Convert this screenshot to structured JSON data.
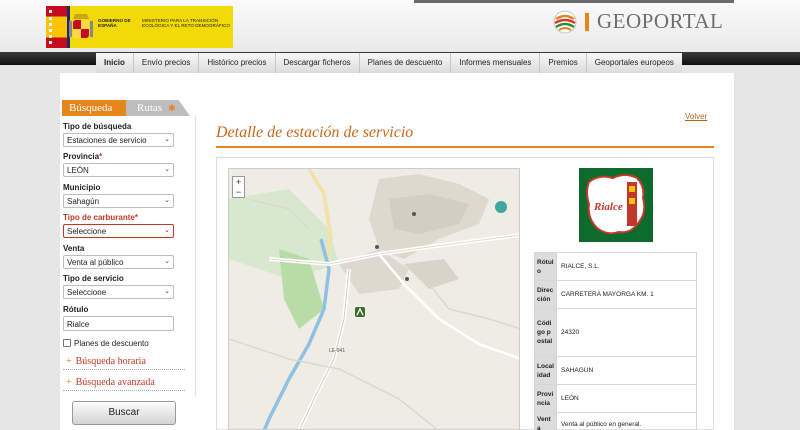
{
  "header": {
    "gov_text": "GOBIERNO DE ESPAÑA",
    "ministry_text": "MINISTERIO PARA LA TRANSICIÓN ECOLÓGICA Y EL RETO DEMOGRÁFICO",
    "brand": "GEOPORTAL"
  },
  "nav": {
    "items": [
      "Inicio",
      "Envío precios",
      "Histórico precios",
      "Descargar ficheros",
      "Planes de descuento",
      "Informes mensuales",
      "Premios",
      "Geoportales europeos"
    ]
  },
  "sidebar": {
    "tab_busqueda": "Búsqueda",
    "tab_rutas": "Rutas",
    "fields": {
      "tipo_busqueda": {
        "label": "Tipo de búsqueda",
        "value": "Estaciones de servicio"
      },
      "provincia": {
        "label": "Provincia",
        "value": "LEÓN"
      },
      "municipio": {
        "label": "Municipio",
        "value": "Sahagún"
      },
      "carburante": {
        "label": "Tipo de carburante",
        "value": "Seleccione"
      },
      "venta": {
        "label": "Venta",
        "value": "Venta al público"
      },
      "servicio": {
        "label": "Tipo de servicio",
        "value": "Seleccione"
      },
      "rotulo": {
        "label": "Rótulo",
        "value": "Rialce"
      }
    },
    "required_mark": "*",
    "planes_label": "Planes de descuento",
    "horaria_label": "Búsqueda horaria",
    "avanzada_label": "Búsqueda avanzada",
    "buscar_label": "Buscar"
  },
  "main": {
    "volver": "Volver",
    "title": "Detalle de estación de servicio",
    "logo_text": "Rialce",
    "map_road_label": "LE-941",
    "info": [
      {
        "key": "Rótulo",
        "value": "RIALCE, S.L."
      },
      {
        "key": "Dirección",
        "value": "CARRETERA MAYORGA KM. 1"
      },
      {
        "key": "Código postal",
        "value": "24320"
      },
      {
        "key": "Localidad",
        "value": "SAHAGUN"
      },
      {
        "key": "Provincia",
        "value": "LEÓN"
      },
      {
        "key": "Venta",
        "value": "Venta al público en general."
      }
    ]
  },
  "colors": {
    "accent": "#e8841c",
    "link": "#b5651d",
    "error": "#c0392b",
    "logo_green": "#0e6b2e"
  }
}
